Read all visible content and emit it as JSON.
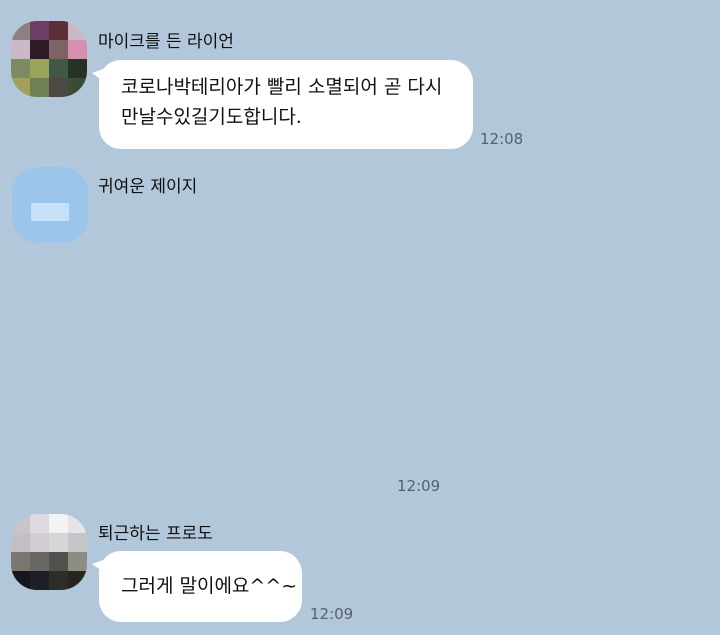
{
  "messages": [
    {
      "sender": "마이크를 든 라이언",
      "avatar_icon": "pixelated-avatar-icon",
      "lines": [
        "코로나박테리아가 빨리 소멸되어 곧 다시",
        "만날수있길기도합니다."
      ],
      "time": "12:08"
    },
    {
      "sender": "귀여운 제이지",
      "avatar_icon": "jay-g-avatar-icon",
      "sticker_icon": "sticker-placeholder-icon",
      "time": "12:09"
    },
    {
      "sender": "퇴근하는 프로도",
      "avatar_icon": "pixelated-avatar-icon",
      "lines": [
        "그러게 말이에요^^~"
      ],
      "time": "12:09"
    }
  ],
  "colors": {
    "background": "#b2c7d9",
    "bubble": "#ffffff",
    "timestamp": "#55616f"
  }
}
